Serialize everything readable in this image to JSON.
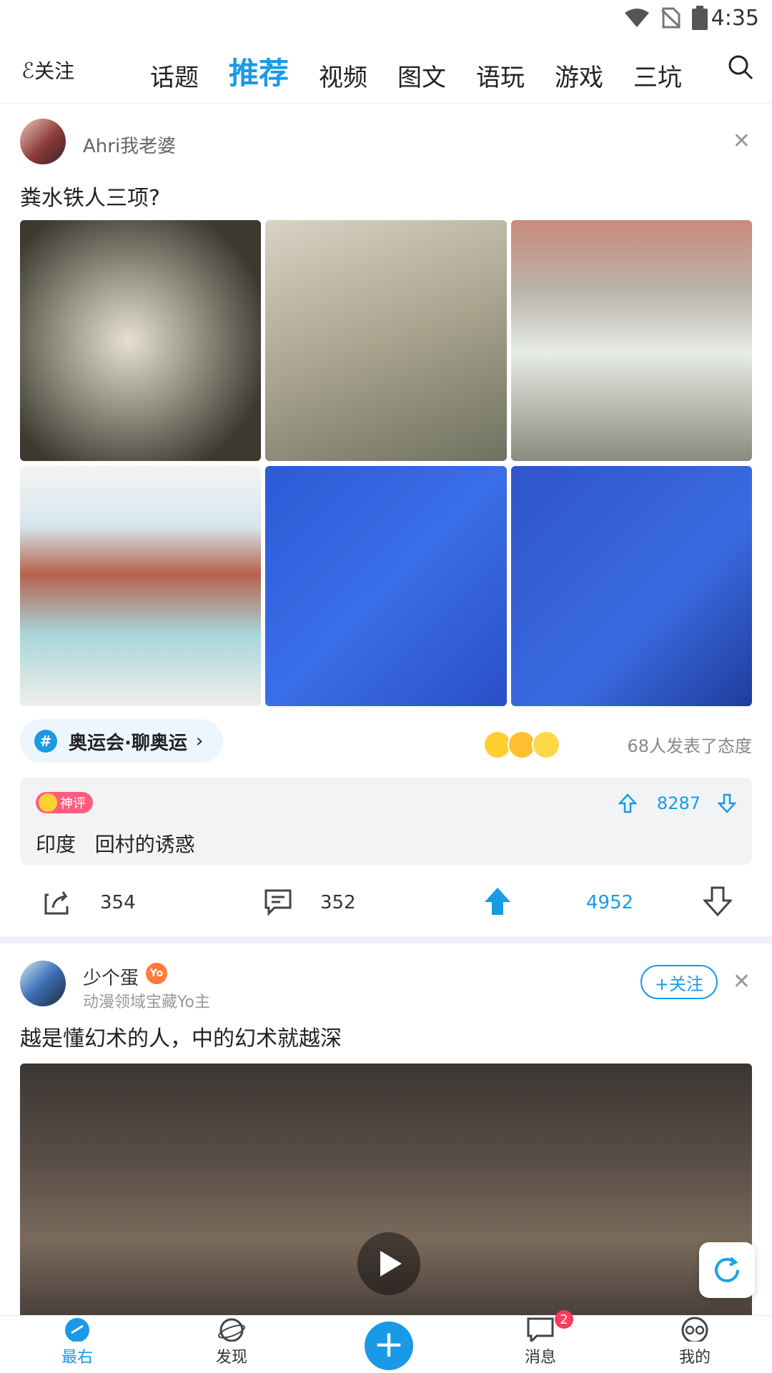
{
  "status": {
    "time": "4:35"
  },
  "nav": {
    "follow": "关注",
    "tabs": [
      "话题",
      "推荐",
      "视频",
      "图文",
      "语玩",
      "游戏",
      "三坑"
    ],
    "active": 1
  },
  "post1": {
    "user": "Ahri我老婆",
    "title": "粪水铁人三项?",
    "topic": "奥运会·聊奥运",
    "reactions": "68人发表了态度",
    "comment": {
      "badge": "神评",
      "text": "印度   回村的诱惑",
      "votes": "8287"
    },
    "shares": "354",
    "comments": "352",
    "ups": "4952"
  },
  "post2": {
    "user": "少个蛋",
    "badge": "Yo",
    "subtitle": "动漫领域宝藏Yo主",
    "follow": "+关注",
    "title": "越是懂幻术的人，中的幻术就越深"
  },
  "bottom": {
    "items": [
      "最右",
      "发现",
      "消息",
      "我的"
    ],
    "messages_badge": "2"
  },
  "colors": {
    "accent": "#1a9ae6"
  }
}
